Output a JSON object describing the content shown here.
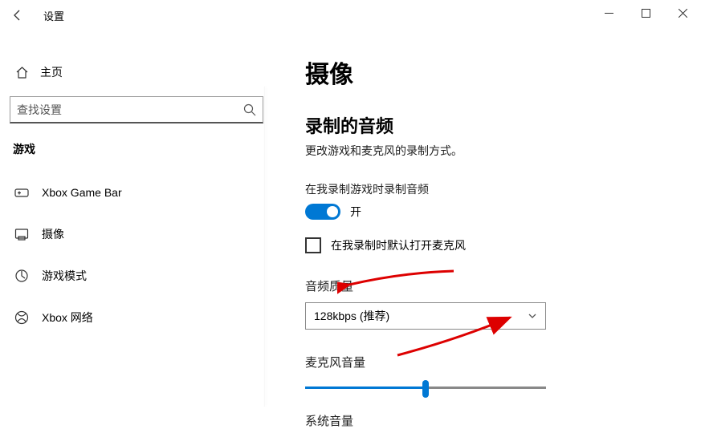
{
  "window": {
    "title": "设置"
  },
  "sidebar": {
    "home_label": "主页",
    "search_placeholder": "查找设置",
    "category": "游戏",
    "items": [
      {
        "label": "Xbox Game Bar"
      },
      {
        "label": "摄像"
      },
      {
        "label": "游戏模式"
      },
      {
        "label": "Xbox 网络"
      }
    ]
  },
  "content": {
    "page_title": "摄像",
    "section_heading": "录制的音频",
    "section_subtext": "更改游戏和麦克风的录制方式。",
    "record_audio_label": "在我录制游戏时录制音频",
    "toggle_state": "开",
    "mic_checkbox_label": "在我录制时默认打开麦克风",
    "audio_quality_label": "音频质量",
    "audio_quality_value": "128kbps (推荐)",
    "mic_volume_label": "麦克风音量",
    "mic_volume_percent": 50,
    "system_volume_label": "系统音量"
  }
}
